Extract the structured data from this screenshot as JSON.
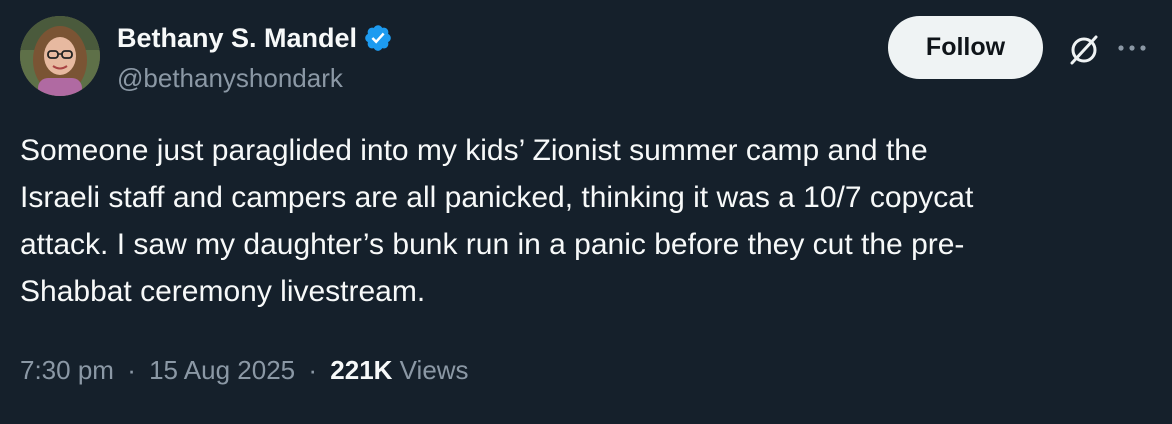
{
  "author": {
    "display_name": "Bethany S. Mandel",
    "handle": "@bethanyshondark",
    "verified": true,
    "avatar_icon": "profile-photo"
  },
  "header": {
    "follow_label": "Follow",
    "grok_icon": "grok-icon",
    "more_icon": "more-dots-icon"
  },
  "tweet": {
    "lines": [
      "Someone just paraglided into my kids’ Zionist summer camp and the",
      "Israeli staff and campers are all panicked, thinking it was a 10/7 copycat",
      "attack. I saw my daughter’s bunk run in a panic before they cut the pre-",
      "Shabbat ceremony livestream."
    ]
  },
  "meta": {
    "time": "7:30 pm",
    "separator": "·",
    "date": "15 Aug 2025",
    "views_count": "221K",
    "views_label": "Views"
  },
  "colors": {
    "background": "#15202b",
    "text": "#f7f9f9",
    "secondary_text": "#8b98a5",
    "verified_blue": "#1d9bf0",
    "follow_bg": "#eff3f4"
  }
}
